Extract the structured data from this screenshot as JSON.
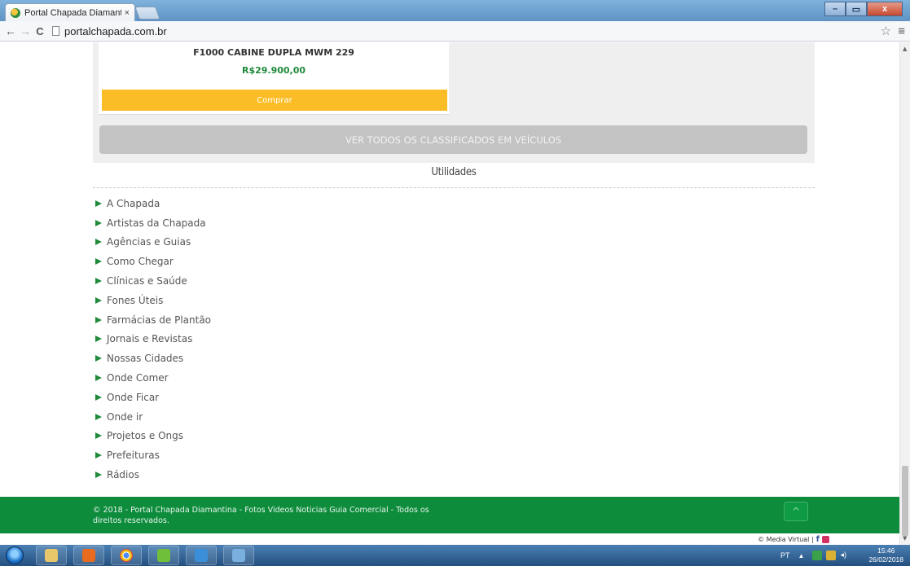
{
  "browser": {
    "tab_title": "Portal Chapada Diamantin",
    "tab_close": "×",
    "url": "portalchapada.com.br",
    "window_controls": [
      "–",
      "▭",
      "x"
    ]
  },
  "listing": {
    "title": "F1000 CABINE DUPLA MWM 229",
    "price": "R$29.900,00",
    "buy_label": "Comprar",
    "all_label": "VER TODOS OS CLASSIFICADOS EM VEÍCULOS"
  },
  "utilidades": {
    "title": "Utilidades",
    "links": [
      "A Chapada",
      "Artistas da Chapada",
      "Agências e Guias",
      "Como Chegar",
      "Clínicas e Saúde",
      "Fones Úteis",
      "Farmácias de Plantão",
      "Jornais e Revistas",
      "Nossas Cidades",
      "Onde Comer",
      "Onde Ficar",
      "Onde ir",
      "Projetos e Ongs",
      "Prefeituras",
      "Rádios"
    ]
  },
  "footer": {
    "copyright": "© 2018 - Portal Chapada Diamantina - Fotos Videos Noticias Guia Comercial - Todos os direitos reservados.",
    "to_top": "^",
    "credit": "© Media Virtual |"
  },
  "taskbar": {
    "lang": "PT",
    "time": "15:46",
    "date": "26/02/2018"
  },
  "colors": {
    "brand_green": "#0d8c3c",
    "buy_yellow": "#fbbd26",
    "price_green": "#1f8a3b"
  },
  "icons": [
    "back-icon",
    "forward-icon",
    "reload-icon",
    "page-icon",
    "star-icon",
    "menu-icon",
    "arrow-right-icon",
    "chevron-up-icon",
    "facebook-icon",
    "instagram-icon",
    "windows-start-icon"
  ]
}
